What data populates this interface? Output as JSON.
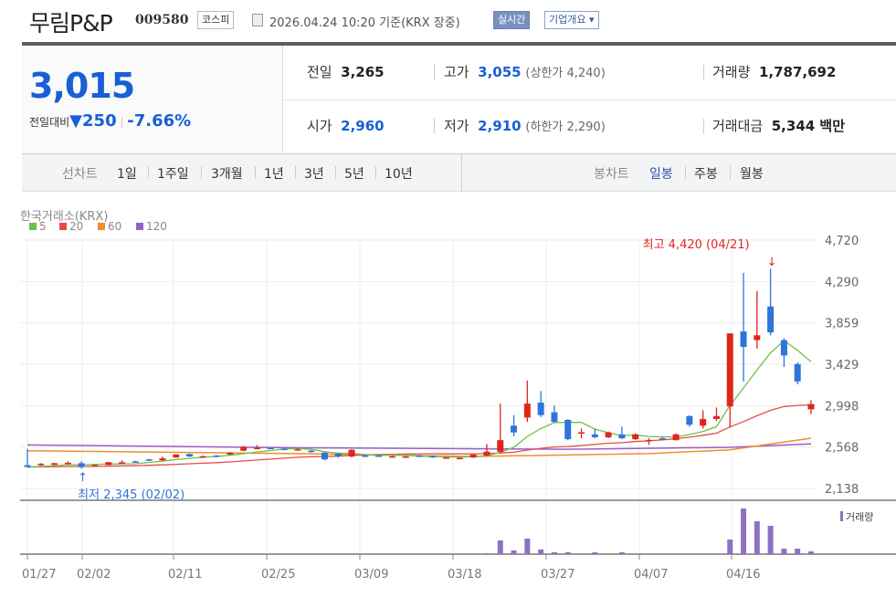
{
  "header": {
    "name": "무림P&P",
    "code": "009580",
    "market": "코스피",
    "datetime": "2026.04.24 10:20 기준(KRX 장중)",
    "realtime": "실시간",
    "overview": "기업개요 ▾"
  },
  "price": {
    "current": "3,015",
    "change_label": "전일대비",
    "change_arrow": "▼",
    "change": "250",
    "change_pct": "-7.66%"
  },
  "info": {
    "prev_label": "전일",
    "prev": "3,265",
    "high_label": "고가",
    "high": "3,055",
    "upper_limit": "(상한가 4,240)",
    "volume_label": "거래량",
    "volume": "1,787,692",
    "open_label": "시가",
    "open": "2,960",
    "low_label": "저가",
    "low": "2,910",
    "lower_limit": "(하한가 2,290)",
    "amount_label": "거래대금",
    "amount": "5,344 백만"
  },
  "tabs": {
    "line_label": "선차트",
    "line": [
      "1일",
      "1주일",
      "3개월",
      "1년",
      "3년",
      "5년",
      "10년"
    ],
    "candle_label": "봉차트",
    "candle": [
      "일봉",
      "주봉",
      "월봉"
    ],
    "active_candle": "일봉"
  },
  "colors": {
    "up": "#e0261b",
    "down": "#2f74d8",
    "ma5": "#6cc24a",
    "ma20": "#e84a4a",
    "ma60": "#f0902a",
    "ma120": "#9a5cc8",
    "volume": "#8e72c0"
  },
  "chart_data": {
    "type": "candlestick",
    "source": "한국거래소(KRX)",
    "legend": [
      "5",
      "20",
      "60",
      "120"
    ],
    "y_ticks": [
      "4,720",
      "4,290",
      "3,859",
      "3,429",
      "2,998",
      "2,568",
      "2,138"
    ],
    "ylim": [
      2138,
      4720
    ],
    "x_ticks": [
      "01/27",
      "02/02",
      "02/11",
      "02/25",
      "03/09",
      "03/18",
      "03/27",
      "04/07",
      "04/16"
    ],
    "high_note": "최고 4,420 (04/21)",
    "low_note": "최저 2,345 (02/02)",
    "volume_legend": "거래량",
    "candles": [
      [
        2380,
        2550,
        2360,
        2360
      ],
      [
        2380,
        2400,
        2375,
        2395
      ],
      [
        2385,
        2405,
        2380,
        2400
      ],
      [
        2400,
        2420,
        2395,
        2405
      ],
      [
        2400,
        2420,
        2345,
        2360
      ],
      [
        2370,
        2385,
        2365,
        2380
      ],
      [
        2380,
        2415,
        2378,
        2410
      ],
      [
        2405,
        2430,
        2400,
        2410
      ],
      [
        2420,
        2425,
        2405,
        2410
      ],
      [
        2440,
        2445,
        2425,
        2430
      ],
      [
        2430,
        2470,
        2425,
        2450
      ],
      [
        2460,
        2495,
        2455,
        2490
      ],
      [
        2495,
        2500,
        2465,
        2470
      ],
      [
        2470,
        2480,
        2460,
        2472
      ],
      [
        2480,
        2485,
        2462,
        2470
      ],
      [
        2490,
        2515,
        2485,
        2510
      ],
      [
        2530,
        2580,
        2525,
        2570
      ],
      [
        2550,
        2590,
        2545,
        2560
      ],
      [
        2560,
        2565,
        2545,
        2550
      ],
      [
        2550,
        2555,
        2540,
        2545
      ],
      [
        2540,
        2560,
        2535,
        2545
      ],
      [
        2530,
        2535,
        2510,
        2520
      ],
      [
        2510,
        2515,
        2430,
        2440
      ],
      [
        2500,
        2505,
        2460,
        2470
      ],
      [
        2470,
        2545,
        2460,
        2540
      ],
      [
        2480,
        2490,
        2465,
        2475
      ],
      [
        2480,
        2485,
        2470,
        2475
      ],
      [
        2470,
        2480,
        2465,
        2472
      ],
      [
        2465,
        2478,
        2460,
        2470
      ],
      [
        2480,
        2485,
        2465,
        2470
      ],
      [
        2475,
        2480,
        2455,
        2460
      ],
      [
        2455,
        2465,
        2450,
        2460
      ],
      [
        2450,
        2460,
        2445,
        2455
      ],
      [
        2460,
        2495,
        2455,
        2490
      ],
      [
        2480,
        2600,
        2475,
        2520
      ],
      [
        2520,
        3020,
        2500,
        2640
      ],
      [
        2790,
        2900,
        2680,
        2720
      ],
      [
        2875,
        3260,
        2830,
        3020
      ],
      [
        3030,
        3150,
        2880,
        2900
      ],
      [
        2930,
        3000,
        2820,
        2830
      ],
      [
        2850,
        2860,
        2640,
        2650
      ],
      [
        2720,
        2760,
        2660,
        2722
      ],
      [
        2700,
        2760,
        2660,
        2670
      ],
      [
        2670,
        2730,
        2660,
        2720
      ],
      [
        2700,
        2780,
        2650,
        2660
      ],
      [
        2650,
        2710,
        2640,
        2700
      ],
      [
        2640,
        2660,
        2590,
        2642
      ],
      [
        2660,
        2680,
        2640,
        2650
      ],
      [
        2640,
        2710,
        2635,
        2700
      ],
      [
        2890,
        2900,
        2780,
        2800
      ],
      [
        2790,
        2950,
        2760,
        2860
      ],
      [
        2860,
        2980,
        2840,
        2890
      ],
      [
        2990,
        3750,
        2770,
        3750
      ],
      [
        3770,
        4380,
        3250,
        3610
      ],
      [
        3680,
        4190,
        3590,
        3730
      ],
      [
        4030,
        4420,
        3730,
        3760
      ],
      [
        3680,
        3700,
        3400,
        3520
      ],
      [
        3430,
        3450,
        3220,
        3250
      ],
      [
        2960,
        3055,
        2910,
        3015
      ]
    ],
    "ma60": [
      [
        0,
        2530
      ],
      [
        20,
        2500
      ],
      [
        33,
        2470
      ],
      [
        46,
        2500
      ],
      [
        52,
        2540
      ],
      [
        58,
        2660
      ]
    ],
    "ma120": [
      [
        0,
        2590
      ],
      [
        20,
        2560
      ],
      [
        40,
        2545
      ],
      [
        52,
        2565
      ],
      [
        58,
        2600
      ]
    ],
    "volume_relative": [
      0,
      0,
      0,
      0,
      0,
      0,
      0,
      0,
      0,
      0,
      0,
      0,
      0,
      0,
      0,
      0,
      0,
      0,
      0,
      0,
      0,
      0,
      0,
      0,
      0,
      0,
      0,
      0,
      0,
      0,
      0,
      0,
      0,
      0,
      1,
      15,
      4,
      17,
      5,
      2,
      2,
      0,
      2,
      0,
      2,
      0,
      0,
      0,
      0,
      0,
      0,
      0,
      16,
      50,
      36,
      31,
      6,
      6,
      3
    ]
  }
}
